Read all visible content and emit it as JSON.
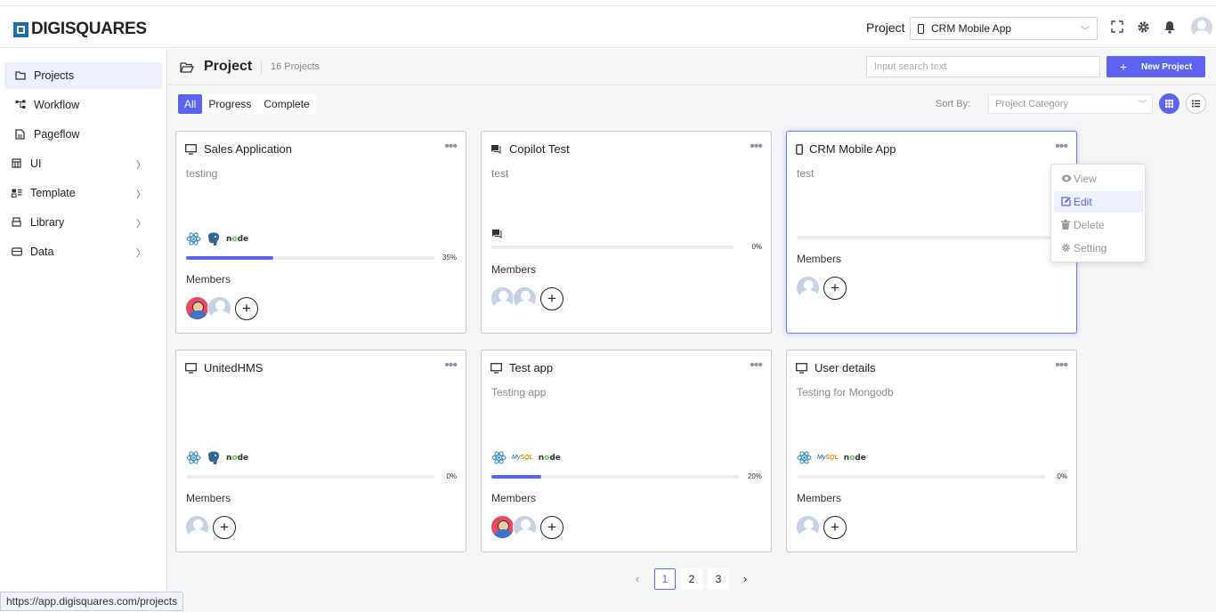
{
  "header": {
    "brand": "DIGISQUARES",
    "project_label": "Project",
    "project_selected": "CRM Mobile App"
  },
  "sidebar": {
    "items": [
      {
        "label": "Projects",
        "icon": "folder-icon",
        "active": true,
        "expandable": false
      },
      {
        "label": "Workflow",
        "icon": "workflow-icon",
        "active": false,
        "expandable": false
      },
      {
        "label": "Pageflow",
        "icon": "pageflow-icon",
        "active": false,
        "expandable": false
      },
      {
        "label": "UI",
        "icon": "ui-icon",
        "active": false,
        "expandable": true
      },
      {
        "label": "Template",
        "icon": "template-icon",
        "active": false,
        "expandable": true
      },
      {
        "label": "Library",
        "icon": "library-icon",
        "active": false,
        "expandable": true
      },
      {
        "label": "Data",
        "icon": "data-icon",
        "active": false,
        "expandable": true
      }
    ]
  },
  "page": {
    "title": "Project",
    "count": "16 Projects",
    "search_placeholder": "Input search text",
    "new_button": "New Project",
    "filters": [
      "All",
      "Progress",
      "Complete"
    ],
    "active_filter": "All",
    "sort_label": "Sort By:",
    "sort_value": "Project Category"
  },
  "projects": [
    {
      "title": "Sales Application",
      "desc": "testing",
      "icon": "monitor-icon",
      "tech": [
        "react",
        "postgres",
        "node"
      ],
      "progress_label": "35%",
      "progress": 35,
      "members_label": "Members",
      "members": [
        "photo",
        "default"
      ]
    },
    {
      "title": "Copilot Test",
      "desc": "test",
      "icon": "chat-icon",
      "tech": [
        "chat"
      ],
      "progress_label": "0%",
      "progress": 0,
      "members_label": "Members",
      "members": [
        "default",
        "default"
      ]
    },
    {
      "title": "CRM Mobile App",
      "desc": "test",
      "icon": "phone-icon",
      "tech": [],
      "progress_label": "",
      "progress": 0,
      "members_label": "Members",
      "members": [
        "default"
      ]
    },
    {
      "title": "UnitedHMS",
      "desc": "",
      "icon": "monitor-icon",
      "tech": [
        "react",
        "postgres",
        "node"
      ],
      "progress_label": "0%",
      "progress": 0,
      "members_label": "Members",
      "members": [
        "default"
      ]
    },
    {
      "title": "Test app",
      "desc": "Testing app",
      "icon": "monitor-icon",
      "tech": [
        "react",
        "mysql",
        "node"
      ],
      "progress_label": "20%",
      "progress": 20,
      "members_label": "Members",
      "members": [
        "photo",
        "default"
      ]
    },
    {
      "title": "User details",
      "desc": "Testing for Mongodb",
      "icon": "monitor-icon",
      "tech": [
        "react",
        "mysql",
        "node"
      ],
      "progress_label": "0%",
      "progress": 0,
      "members_label": "Members",
      "members": [
        "default"
      ]
    }
  ],
  "context_menu": {
    "items": [
      {
        "label": "View",
        "icon": "eye-icon",
        "highlighted": false
      },
      {
        "label": "Edit",
        "icon": "edit-icon",
        "highlighted": true
      },
      {
        "label": "Delete",
        "icon": "trash-icon",
        "highlighted": false
      },
      {
        "label": "Setting",
        "icon": "gear-icon",
        "highlighted": false
      }
    ]
  },
  "pagination": {
    "pages": [
      "1",
      "2",
      "3"
    ],
    "current": "1"
  },
  "status_url": "https://app.digisquares.com/projects",
  "colors": {
    "accent": "#5b63f0",
    "brand": "#1a6fa8"
  }
}
